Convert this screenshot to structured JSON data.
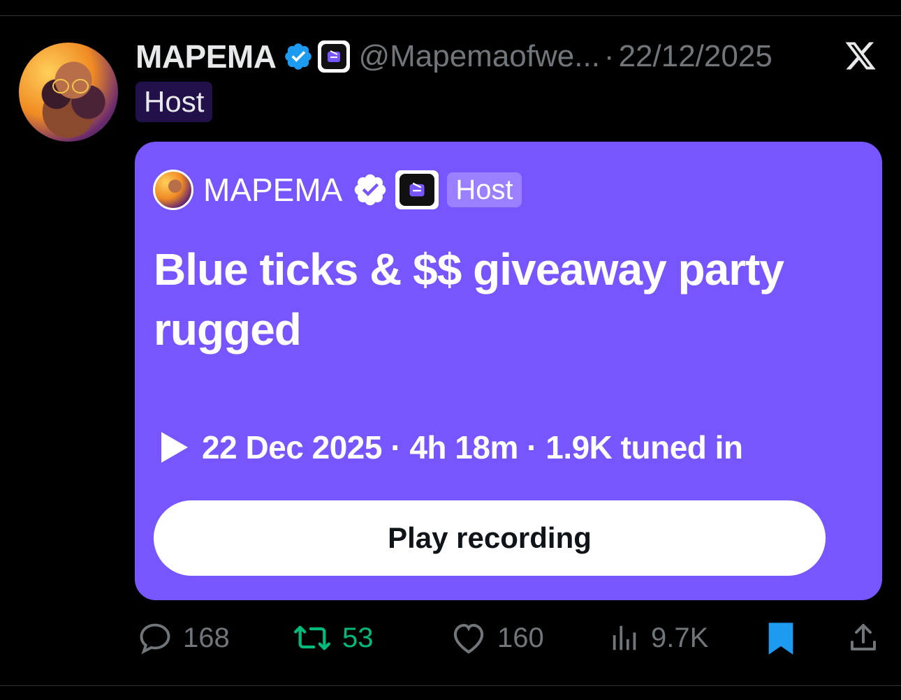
{
  "post": {
    "author_name": "MAPEMA",
    "handle": "@Mapemaofwe...",
    "separator": "·",
    "date": "22/12/2025",
    "role_label": "Host"
  },
  "card": {
    "host_name": "MAPEMA",
    "role_label": "Host",
    "title": "Blue ticks & $$ giveaway party rugged",
    "meta": "22 Dec 2025 · 4h 18m · 1.9K tuned in",
    "play_button_label": "Play recording",
    "background_color": "#7856ff"
  },
  "actions": {
    "replies": "168",
    "reposts": "53",
    "likes": "160",
    "views": "9.7K",
    "bookmarked": true
  },
  "icons": {
    "verified": "verified-badge-icon",
    "app": "spaces-app-icon",
    "brand": "x-logo-icon",
    "play": "play-icon",
    "reply": "reply-icon",
    "repost": "repost-icon",
    "like": "heart-icon",
    "views": "views-icon",
    "bookmark": "bookmark-icon",
    "share": "share-icon"
  },
  "colors": {
    "verified_blue": "#1d9bf0",
    "repost_green": "#00ba7c",
    "muted": "#71767b"
  }
}
